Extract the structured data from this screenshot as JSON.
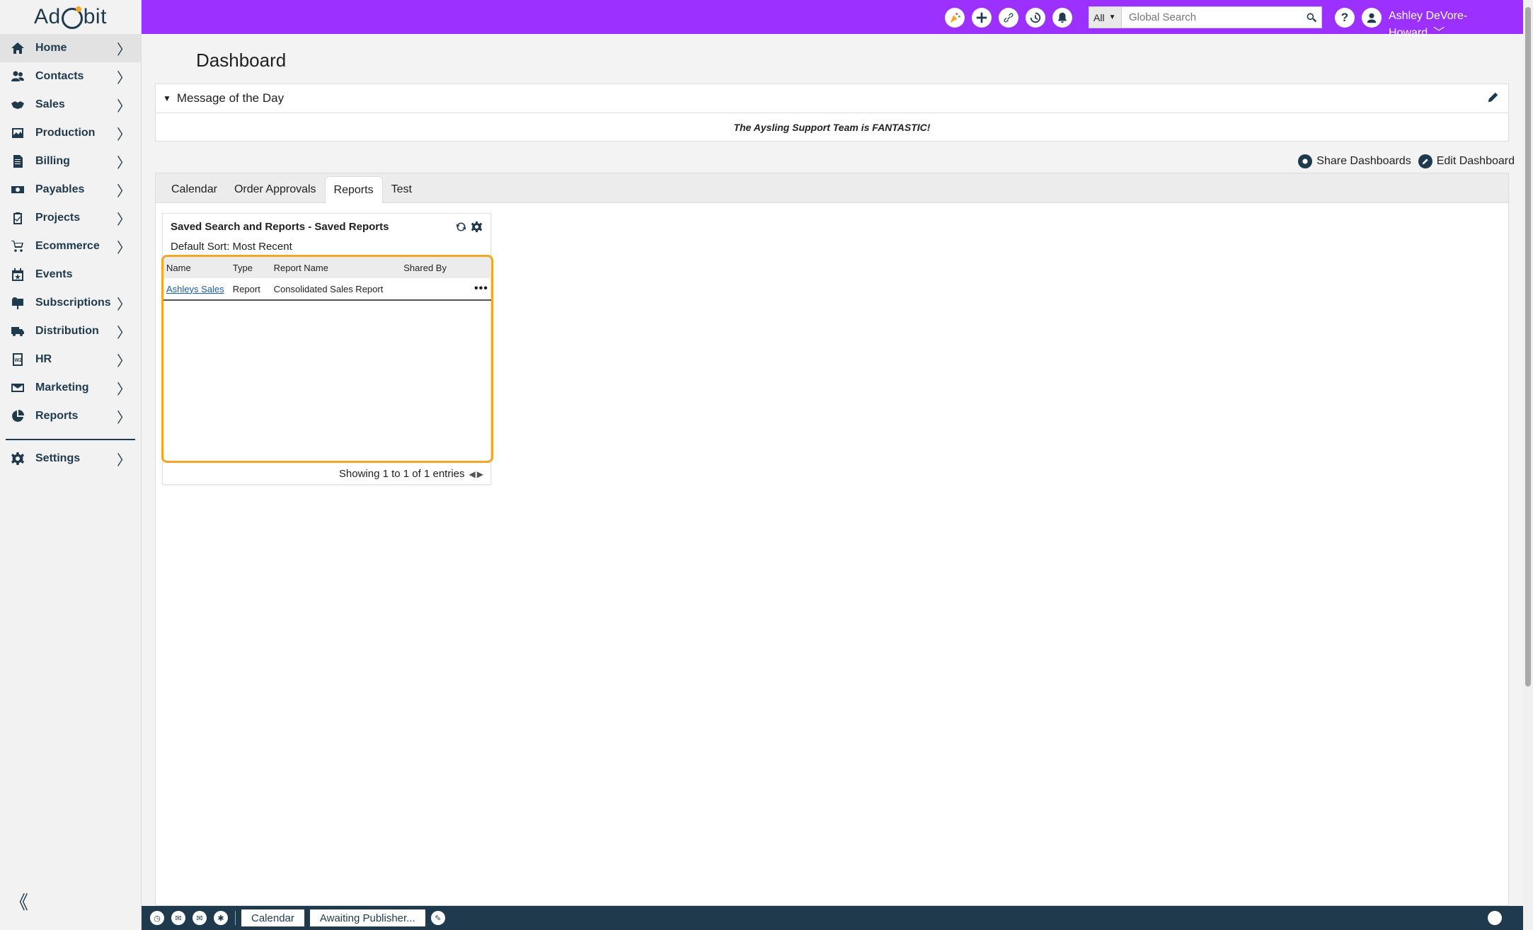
{
  "app": {
    "logo_text_left": "Ad",
    "logo_text_right": "bit"
  },
  "sidebar": {
    "items": [
      {
        "label": "Home",
        "icon": "home-icon"
      },
      {
        "label": "Contacts",
        "icon": "contacts-icon"
      },
      {
        "label": "Sales",
        "icon": "handshake-icon"
      },
      {
        "label": "Production",
        "icon": "image-icon"
      },
      {
        "label": "Billing",
        "icon": "invoice-icon"
      },
      {
        "label": "Payables",
        "icon": "money-icon"
      },
      {
        "label": "Projects",
        "icon": "clipboard-icon"
      },
      {
        "label": "Ecommerce",
        "icon": "cart-icon"
      },
      {
        "label": "Events",
        "icon": "calendar-icon"
      },
      {
        "label": "Subscriptions",
        "icon": "mailbox-icon"
      },
      {
        "label": "Distribution",
        "icon": "truck-icon"
      },
      {
        "label": "HR",
        "icon": "w2-icon"
      },
      {
        "label": "Marketing",
        "icon": "envelope-icon"
      },
      {
        "label": "Reports",
        "icon": "chart-icon"
      }
    ],
    "settings_label": "Settings",
    "chevron": "〉",
    "collapse": "《"
  },
  "topbar": {
    "search_scope": "All",
    "search_placeholder": "Global Search",
    "user_name": "Ashley DeVore-Howard",
    "accent": "#9b30ff"
  },
  "main": {
    "page_title": "Dashboard",
    "motd": {
      "title": "Message of the Day",
      "message": "The Aysling Support Team is FANTASTIC!"
    },
    "share_label": "Share Dashboards",
    "edit_label": "Edit Dashboard",
    "tabs": [
      {
        "label": "Calendar"
      },
      {
        "label": "Order Approvals"
      },
      {
        "label": "Reports"
      },
      {
        "label": "Test"
      }
    ],
    "widget": {
      "title": "Saved Search and Reports - Saved Reports",
      "sort": "Default Sort: Most Recent",
      "columns": [
        "Name",
        "Type",
        "Report Name",
        "Shared By"
      ],
      "rows": [
        {
          "name": "Ashleys Sales",
          "type": "Report",
          "report_name": "Consolidated Sales Report",
          "shared_by": "",
          "menu": "•••"
        }
      ],
      "footer": "Showing 1 to 1 of 1 entries"
    }
  },
  "bottombar": {
    "buttons": [
      "Calendar",
      "Awaiting Publisher..."
    ]
  }
}
